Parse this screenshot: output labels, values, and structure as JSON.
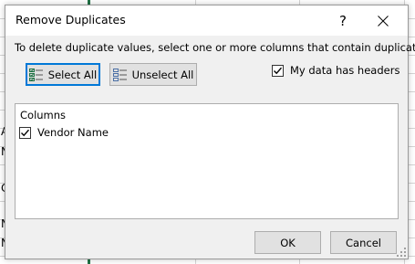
{
  "sheet": {
    "row_fragments": [
      "",
      "",
      "",
      "",
      "",
      "",
      "",
      "A",
      "N",
      "",
      "C",
      "",
      "N",
      "N"
    ]
  },
  "dialog": {
    "title": "Remove Duplicates",
    "help_label": "?",
    "instruction": "To delete duplicate values, select one or more columns that contain duplicates.",
    "select_all_label": "Select All",
    "unselect_all_label": "Unselect All",
    "headers_checkbox": {
      "label": "My data has headers",
      "checked": true
    },
    "columns": {
      "title": "Columns",
      "items": [
        {
          "label": "Vendor Name",
          "checked": true
        }
      ]
    },
    "ok_label": "OK",
    "cancel_label": "Cancel"
  },
  "icons": {
    "help": "help-icon",
    "close": "close-icon",
    "select_all": "select-all-icon",
    "unselect_all": "unselect-all-icon",
    "check": "checkmark-icon",
    "grip": "resize-grip-icon"
  },
  "colors": {
    "dialog_bg": "#f0f0f0",
    "titlebar_bg": "#ffffff",
    "button_bg": "#e1e1e1",
    "focus_border": "#0078d7",
    "select_all_icon": "#217346",
    "excel_green": "#217346"
  }
}
